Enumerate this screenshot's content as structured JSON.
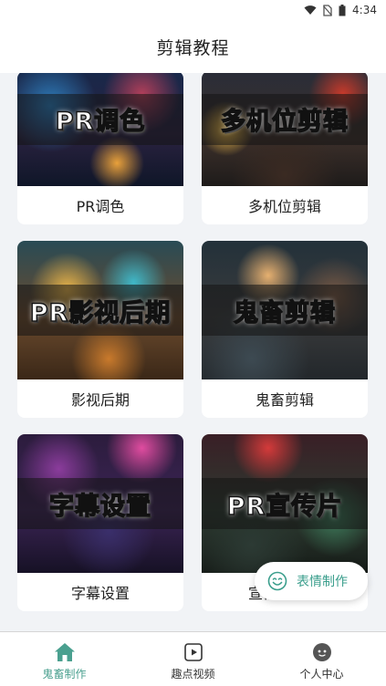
{
  "status_bar": {
    "time": "4:34"
  },
  "header": {
    "title": "剪辑教程"
  },
  "tutorials": [
    {
      "label": "PR调色",
      "banner": "PR调色"
    },
    {
      "label": "多机位剪辑",
      "banner": "多机位剪辑"
    },
    {
      "label": "影视后期",
      "banner": "PR影视后期"
    },
    {
      "label": "鬼畜剪辑",
      "banner": "鬼畜剪辑"
    },
    {
      "label": "字幕设置",
      "banner": "字幕设置"
    },
    {
      "label": "宣传片制作",
      "banner": "PR宣传片"
    }
  ],
  "fab": {
    "label": "表情制作"
  },
  "bottom_nav": {
    "items": [
      {
        "label": "鬼畜制作",
        "icon": "home-icon",
        "active": true
      },
      {
        "label": "趣点视频",
        "icon": "video-icon",
        "active": false
      },
      {
        "label": "个人中心",
        "icon": "profile-icon",
        "active": false
      }
    ]
  },
  "colors": {
    "accent": "#4aa08f",
    "background": "#f1f3f6"
  }
}
